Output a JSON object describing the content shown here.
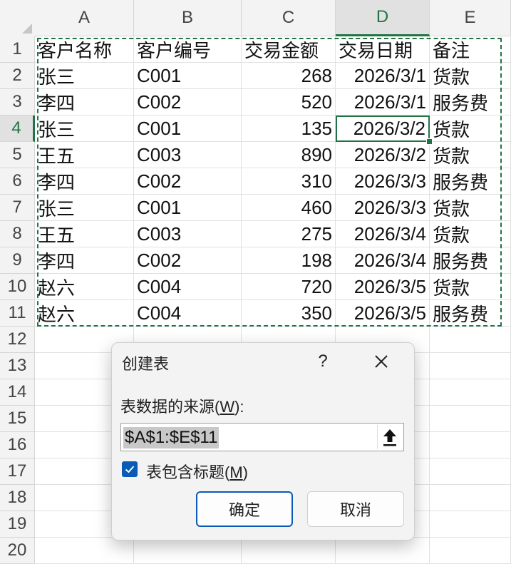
{
  "sheet": {
    "columns": [
      "A",
      "B",
      "C",
      "D",
      "E"
    ],
    "row_numbers": [
      "1",
      "2",
      "3",
      "4",
      "5",
      "6",
      "7",
      "8",
      "9",
      "10",
      "11",
      "12",
      "13",
      "14",
      "15",
      "16",
      "17",
      "18",
      "19",
      "20"
    ],
    "rows": [
      [
        "客户名称",
        "客户编号",
        "交易金额",
        "交易日期",
        "备注"
      ],
      [
        "张三",
        "C001",
        "268",
        "2026/3/1",
        "货款"
      ],
      [
        "李四",
        "C002",
        "520",
        "2026/3/1",
        "服务费"
      ],
      [
        "张三",
        "C001",
        "135",
        "2026/3/2",
        "货款"
      ],
      [
        "王五",
        "C003",
        "890",
        "2026/3/2",
        "货款"
      ],
      [
        "李四",
        "C002",
        "310",
        "2026/3/3",
        "服务费"
      ],
      [
        "张三",
        "C001",
        "460",
        "2026/3/3",
        "货款"
      ],
      [
        "王五",
        "C003",
        "275",
        "2026/3/4",
        "货款"
      ],
      [
        "李四",
        "C002",
        "198",
        "2026/3/4",
        "服务费"
      ],
      [
        "赵六",
        "C004",
        "720",
        "2026/3/5",
        "货款"
      ],
      [
        "赵六",
        "C004",
        "350",
        "2026/3/5",
        "服务费"
      ]
    ],
    "active_cell": "D4",
    "accent_color": "#217346"
  },
  "dialog": {
    "title": "创建表",
    "help_label": "?",
    "close_icon": "close-icon",
    "source_label_pre": "表数据的来源(",
    "source_label_key": "W",
    "source_label_post": "):",
    "range_value": "$A$1:$E$11",
    "collapse_icon": "collapse-arrow-icon",
    "has_headers_checked": true,
    "has_headers_pre": "表包含标题(",
    "has_headers_key": "M",
    "has_headers_post": ")",
    "ok_label": "确定",
    "cancel_label": "取消",
    "checkbox_color": "#0a5bb5"
  }
}
